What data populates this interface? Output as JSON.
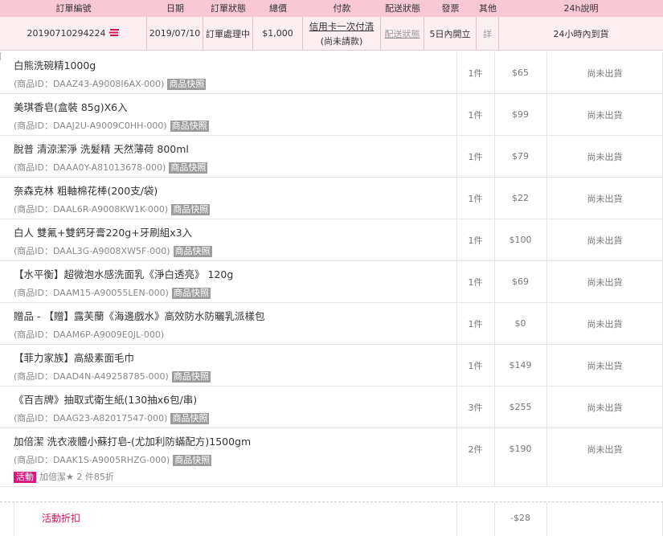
{
  "header": {
    "order_no": "訂單編號",
    "date": "日期",
    "order_status": "訂單狀態",
    "total": "總價",
    "payment": "付款",
    "shipping_status": "配送狀態",
    "invoice": "發票",
    "other": "其他",
    "note_24h": "24h說明"
  },
  "order": {
    "order_no": "20190710294224",
    "date": "2019/07/10",
    "status": "訂單處理中",
    "total": "$1,000",
    "payment_method": "信用卡一次付清",
    "payment_state": "(尚未請款)",
    "shipping_status": "配送狀態",
    "invoice": "5日內開立",
    "other": "詳",
    "note_24h": "24小時內到貨"
  },
  "snapshot_label": "商品快照",
  "items": [
    {
      "name": "白熊洗碗精1000g",
      "pid": "(商品ID：DAAZ43-A9008I6AX-000)",
      "qty": "1件",
      "price": "$65",
      "status": "尚未出貨"
    },
    {
      "name": "美琪香皂(盒裝 85g)X6入",
      "pid": "(商品ID：DAAJ2U-A9009C0HH-000)",
      "qty": "1件",
      "price": "$99",
      "status": "尚未出貨"
    },
    {
      "name": "脫普 清涼潔淨 洗髮精 天然薄荷 800ml",
      "pid": "(商品ID：DAAA0Y-A81013678-000)",
      "qty": "1件",
      "price": "$79",
      "status": "尚未出貨"
    },
    {
      "name": "奈森克林 粗軸棉花棒(200支/袋)",
      "pid": "(商品ID：DAAL6R-A9008KW1K-000)",
      "qty": "1件",
      "price": "$22",
      "status": "尚未出貨"
    },
    {
      "name": "白人 雙氟+雙鈣牙膏220g+牙刷組x3入",
      "pid": "(商品ID：DAAL3G-A9008XW5F-000)",
      "qty": "1件",
      "price": "$100",
      "status": "尚未出貨"
    },
    {
      "name": "【水平衡】超微泡水感洗面乳《淨白透亮》 120g",
      "pid": "(商品ID：DAAM15-A90055LEN-000)",
      "qty": "1件",
      "price": "$69",
      "status": "尚未出貨"
    },
    {
      "name": "贈品 - 【贈】露芙蘭《海邊戲水》高效防水防曬乳派樣包",
      "pid": "(商品ID：DAAM6P-A9009E0JL-000)",
      "qty": "1件",
      "price": "$0",
      "status": "尚未出貨",
      "no_snapshot": true
    },
    {
      "name": "【菲力家族】高級素面毛巾",
      "pid": "(商品ID：DAAD4N-A49258785-000)",
      "qty": "1件",
      "price": "$149",
      "status": "尚未出貨"
    },
    {
      "name": "《百吉牌》抽取式衛生紙(130抽x6包/串)",
      "pid": "(商品ID：DAAG23-A82017547-000)",
      "qty": "3件",
      "price": "$255",
      "status": "尚未出貨"
    },
    {
      "name": "加倍潔 洗衣液體小蘇打皂-(尤加利防蟎配方)1500gm",
      "pid": "(商品ID：DAAK1S-A9005RHZG-000)",
      "qty": "2件",
      "price": "$190",
      "status": "尚未出貨",
      "promo_badge": "活動",
      "promo_text": "加倍潔★ 2 件85折"
    }
  ],
  "discount": {
    "label": "活動折扣",
    "price": "-$28"
  },
  "colors": {
    "header_bg": "#f9c8d6",
    "order_row_bg": "#fdeef2",
    "promo": "#e0137f",
    "discount": "#d4145a",
    "icon": "#d4145a"
  },
  "icons": {
    "order_icon": "list-icon"
  }
}
